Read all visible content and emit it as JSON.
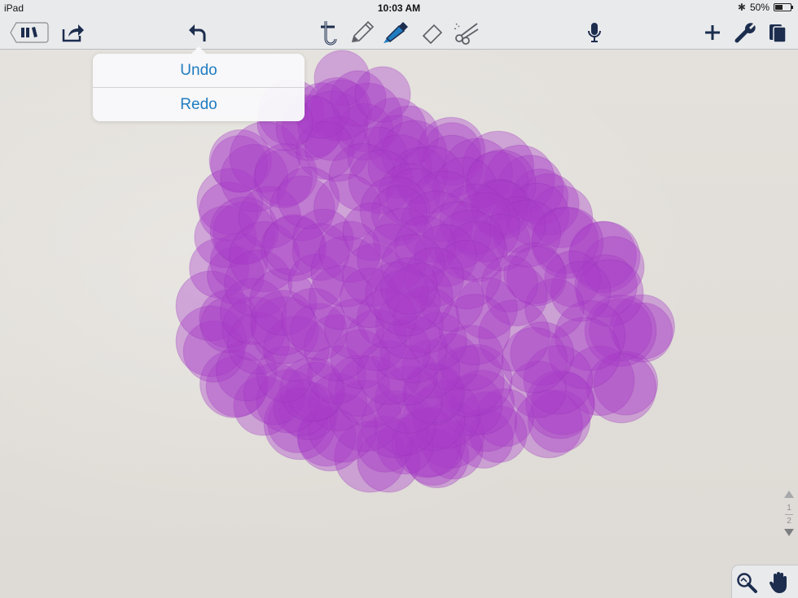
{
  "status_bar": {
    "device": "iPad",
    "time": "10:03 AM",
    "battery": "50%",
    "battery_level": 0.5
  },
  "toolbar": {
    "icons": [
      "library-icon",
      "share-icon",
      "undo-icon",
      "text-tool-icon",
      "pen-icon",
      "highlighter-icon",
      "eraser-icon",
      "scissors-icon",
      "microphone-icon",
      "add-icon",
      "wrench-icon",
      "pages-icon"
    ]
  },
  "popover": {
    "undo_label": "Undo",
    "redo_label": "Redo"
  },
  "pager": {
    "current": "1",
    "total": "2"
  },
  "colors": {
    "accent": "#1f7cc1",
    "ink": "#a83cc9",
    "toolbar": "#e9eaec",
    "paper": "#e3e0db"
  }
}
